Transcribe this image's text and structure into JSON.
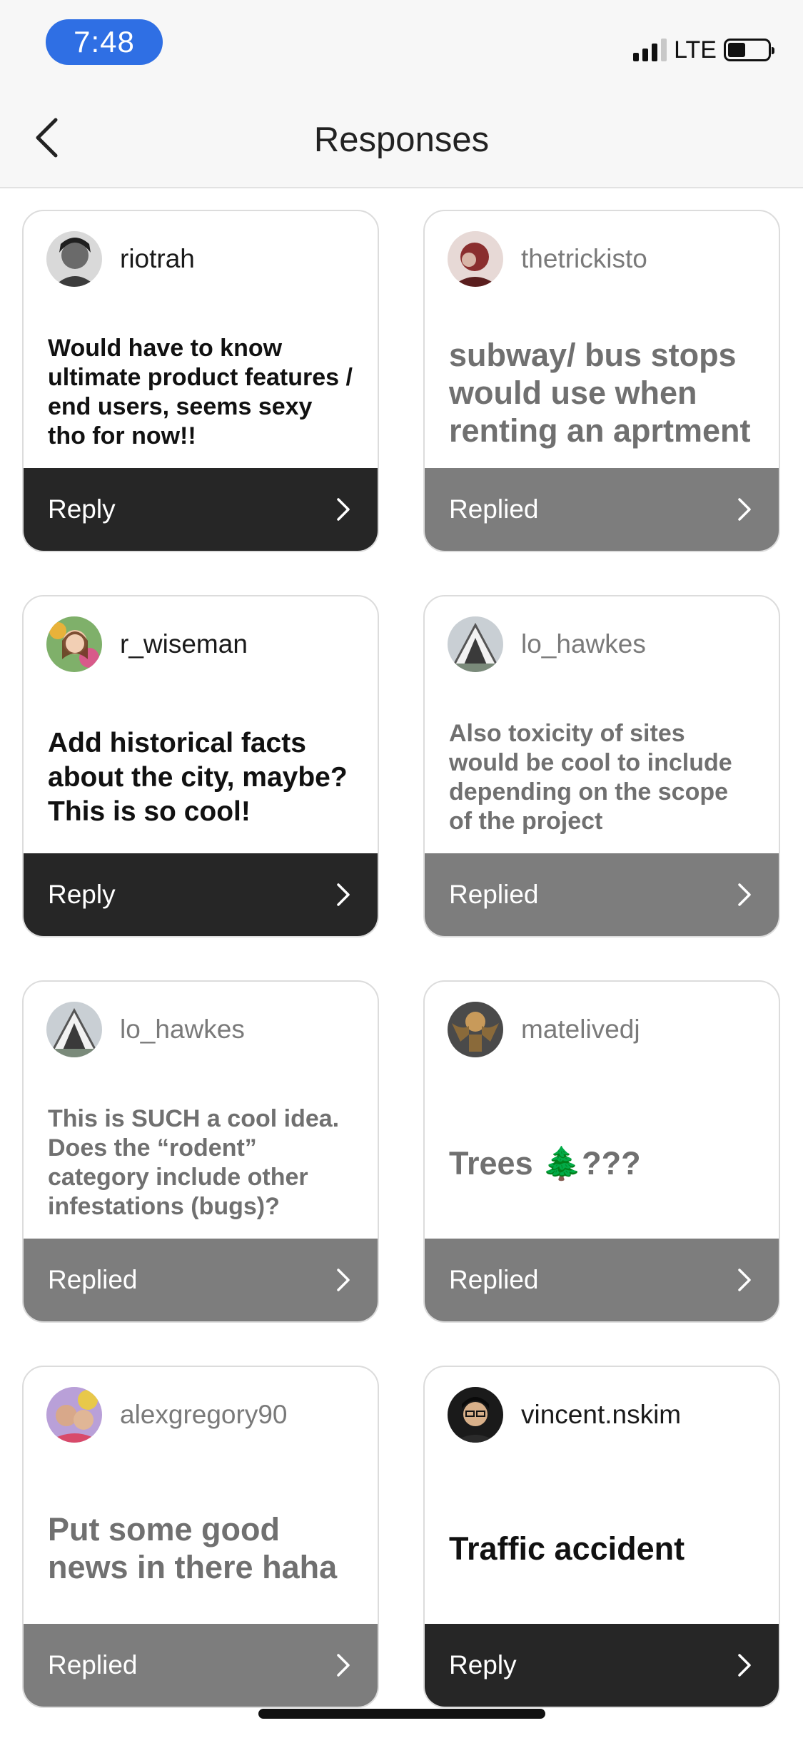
{
  "status": {
    "time": "7:48",
    "network": "LTE",
    "accent": "#2f6fe4"
  },
  "header": {
    "title": "Responses",
    "back_icon": "chevron-left-icon"
  },
  "responses": [
    {
      "username": "riotrah",
      "text": "Would have to know ultimate product features / end users, seems sexy tho for now!!",
      "action": "Reply",
      "state": "active"
    },
    {
      "username": "thetrickisto",
      "text": "subway/ bus stops would use when renting an aprtment",
      "action": "Replied",
      "state": "done"
    },
    {
      "username": "r_wiseman",
      "text": "Add historical facts about the city, maybe? This is so cool!",
      "action": "Reply",
      "state": "active"
    },
    {
      "username": "lo_hawkes",
      "text": "Also toxicity of sites would be cool to include depending on the scope of the project",
      "action": "Replied",
      "state": "done"
    },
    {
      "username": "lo_hawkes",
      "text": "This is SUCH a cool idea. Does the “rodent” category include other infestations (bugs)?",
      "action": "Replied",
      "state": "done"
    },
    {
      "username": "matelivedj",
      "text": "Trees 🌲???",
      "action": "Replied",
      "state": "done"
    },
    {
      "username": "alexgregory90",
      "text": "Put some good news in there haha",
      "action": "Replied",
      "state": "done"
    },
    {
      "username": "vincent.nskim",
      "text": "Traffic accident",
      "action": "Reply",
      "state": "active"
    }
  ],
  "colors": {
    "reply_button": "#262626",
    "replied_button": "#7d7d7d"
  }
}
